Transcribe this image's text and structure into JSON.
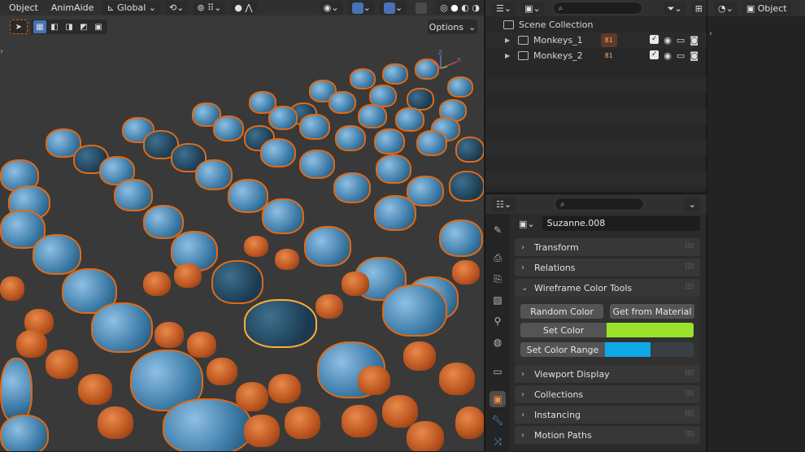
{
  "viewport": {
    "menu": [
      "Object",
      "AnimAide"
    ],
    "orientation": "Global",
    "options_label": "Options",
    "gizmo": {
      "z": "Z",
      "x": "X"
    }
  },
  "outliner": {
    "scene_collection": "Scene Collection",
    "rows": [
      {
        "name": "Monkeys_1",
        "badge": "81"
      },
      {
        "name": "Monkeys_2",
        "badge": "81"
      }
    ]
  },
  "right_header": {
    "mode": "Object"
  },
  "properties": {
    "object_name": "Suzanne.008",
    "panels": {
      "transform": "Transform",
      "relations": "Relations",
      "wireframe_color_tools": "Wireframe Color Tools",
      "viewport_display": "Viewport Display",
      "collections": "Collections",
      "instancing": "Instancing",
      "motion_paths": "Motion Paths"
    },
    "wireframe": {
      "random_color": "Random Color",
      "get_from_material": "Get from Material",
      "set_color": "Set Color",
      "set_color_range": "Set Color Range",
      "color": "#9be22d",
      "range_color": "#0fa8e6"
    }
  },
  "colors": {
    "selection_outline": "#e06a16",
    "active_tab": "#4772b3"
  }
}
